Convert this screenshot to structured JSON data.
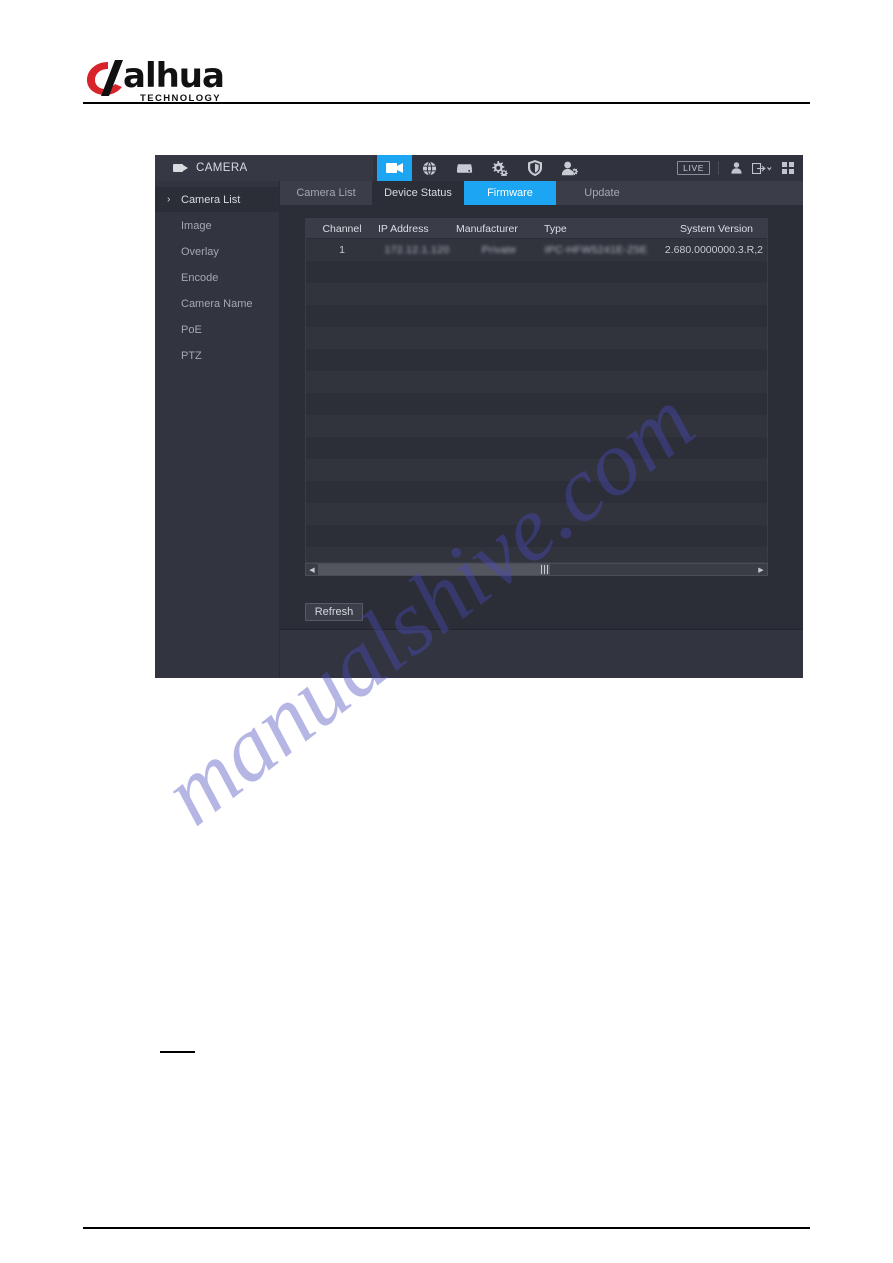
{
  "document": {
    "brand_name": "alhua",
    "brand_tagline": "TECHNOLOGY",
    "watermark": "manualshive.com"
  },
  "ui": {
    "header": {
      "module_title": "CAMERA",
      "module_icon": "camera-icon",
      "nav_icons": [
        {
          "name": "camera-icon",
          "active": true
        },
        {
          "name": "network-globe-icon",
          "active": false
        },
        {
          "name": "storage-drive-icon",
          "active": false
        },
        {
          "name": "system-gears-icon",
          "active": false
        },
        {
          "name": "security-shield-icon",
          "active": false
        },
        {
          "name": "account-user-icon",
          "active": false
        }
      ],
      "live_badge": "LIVE",
      "right_icons": [
        {
          "name": "user-icon"
        },
        {
          "name": "logout-icon"
        },
        {
          "name": "apps-grid-icon"
        }
      ]
    },
    "sidebar": {
      "items": [
        {
          "label": "Camera List",
          "active": true,
          "chevron": "›"
        },
        {
          "label": "Image",
          "active": false
        },
        {
          "label": "Overlay",
          "active": false
        },
        {
          "label": "Encode",
          "active": false
        },
        {
          "label": "Camera Name",
          "active": false
        },
        {
          "label": "PoE",
          "active": false
        },
        {
          "label": "PTZ",
          "active": false
        }
      ]
    },
    "tabs": [
      {
        "label": "Camera List",
        "state": "plain"
      },
      {
        "label": "Device Status",
        "state": "onpane"
      },
      {
        "label": "Firmware",
        "state": "active"
      },
      {
        "label": "Update",
        "state": "plain"
      }
    ],
    "table": {
      "columns": [
        "Channel",
        "IP Address",
        "Manufacturer",
        "Type",
        "System Version"
      ],
      "rows": [
        {
          "channel": "1",
          "ip_address": "172.12.1.120",
          "manufacturer": "Private",
          "type": "IPC-HFW5241E-Z5E",
          "system_version": "2.680.0000000.3.R,2",
          "redacted": true
        }
      ],
      "empty_row_count": 14
    },
    "scrollbar": {
      "left_arrow": "◀",
      "right_arrow": "▶",
      "orientation": "horizontal"
    },
    "buttons": {
      "refresh": "Refresh"
    },
    "colors": {
      "accent": "#1ca5f2",
      "panel_bg": "#2b2d37",
      "sidebar_bg": "#32343f",
      "header_bg": "#30323d",
      "tabstrip_bg": "#3b3d49",
      "table_header_bg": "#3a3c47",
      "text_primary": "#d9dbe1",
      "text_muted": "#a5a8b2",
      "watermark": "#4b4bbf"
    }
  }
}
